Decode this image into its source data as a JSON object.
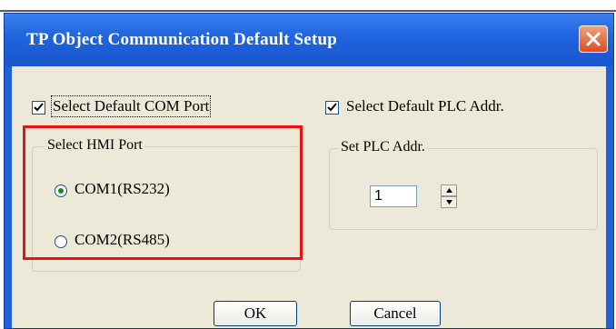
{
  "window": {
    "title": "TP Object Communication Default Setup"
  },
  "left_panel": {
    "checkbox_label": "Select Default COM Port",
    "checkbox_checked": true,
    "group_title": "Select HMI Port",
    "options": [
      {
        "label": "COM1(RS232)",
        "selected": true
      },
      {
        "label": "COM2(RS485)",
        "selected": false
      }
    ]
  },
  "right_panel": {
    "checkbox_label": "Select Default PLC Addr.",
    "checkbox_checked": true,
    "group_title": "Set PLC Addr.",
    "plc_addr_value": "1"
  },
  "buttons": {
    "ok": "OK",
    "cancel": "Cancel"
  },
  "colors": {
    "titlebar": "#1f63de",
    "highlight": "#ee1111",
    "dialog_bg": "#ece9d8"
  },
  "icons": {
    "close": "close-icon",
    "check": "checkmark-icon",
    "spin_up": "chevron-up-icon",
    "spin_down": "chevron-down-icon"
  }
}
